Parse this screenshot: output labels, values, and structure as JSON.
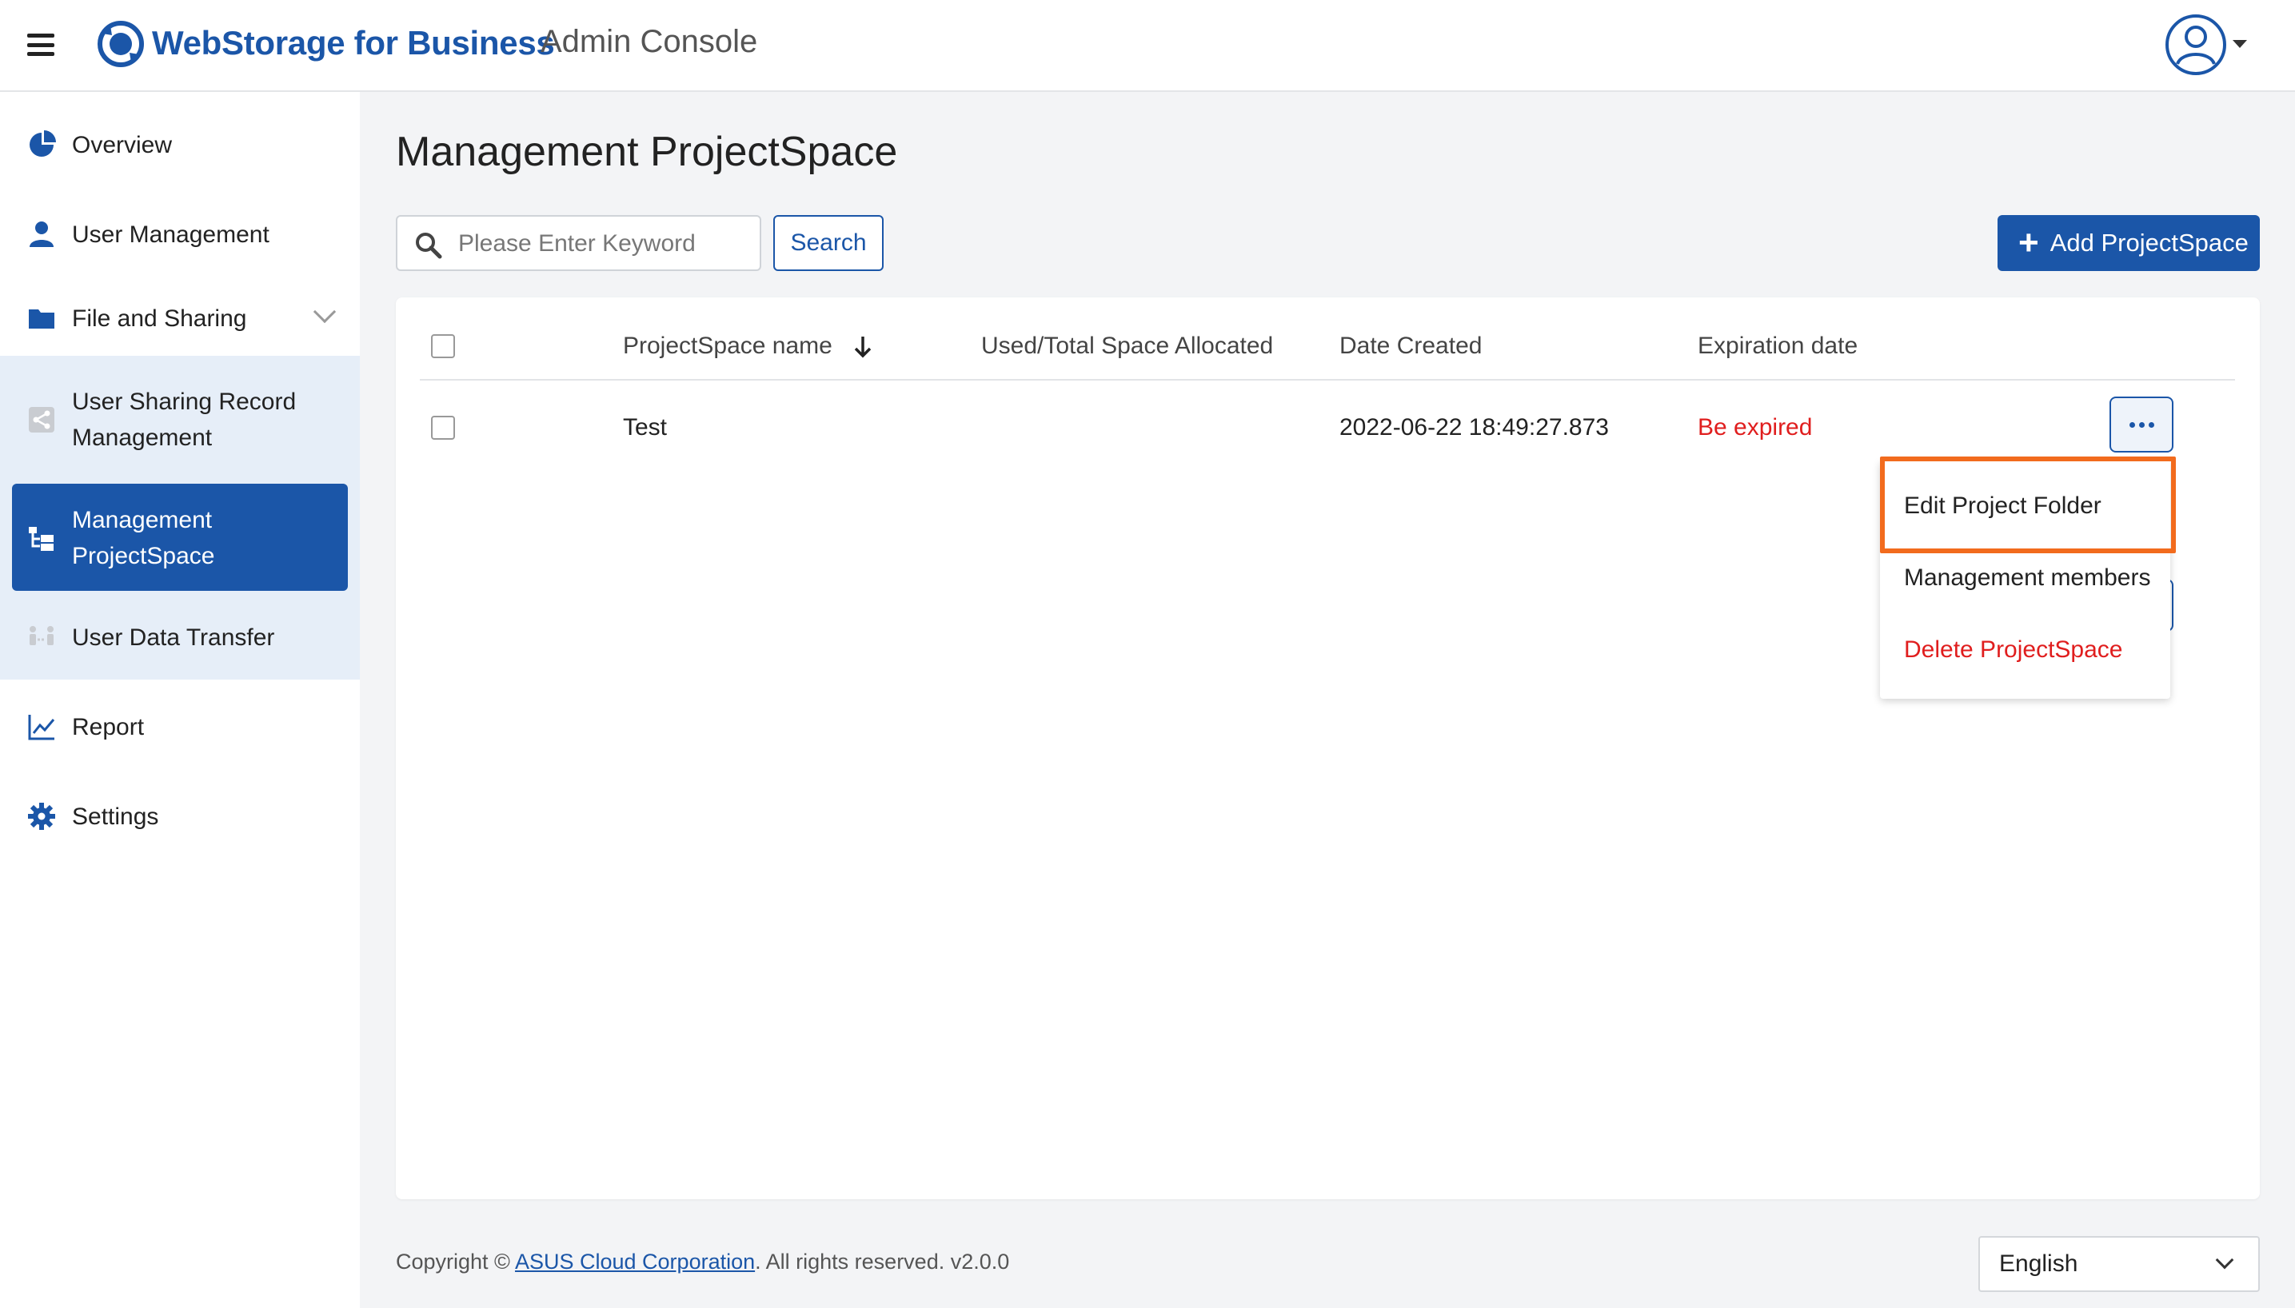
{
  "header": {
    "brand": "WebStorage for Business",
    "subtitle": "Admin Console",
    "menu_icon": "hamburger-icon",
    "avatar_icon": "user-avatar-icon",
    "brand_color": "#1b56a8"
  },
  "sidebar": {
    "items": [
      {
        "label": "Overview",
        "icon": "pie-chart-icon"
      },
      {
        "label": "User Management",
        "icon": "user-icon"
      },
      {
        "label": "File and Sharing",
        "icon": "folder-icon",
        "expanded": true
      },
      {
        "label": "User Sharing Record\nManagement",
        "icon": "share-icon"
      },
      {
        "label": "Management\nProjectSpace",
        "icon": "project-tree-icon",
        "active": true
      },
      {
        "label": "User Data Transfer",
        "icon": "transfer-icon"
      },
      {
        "label": "Report",
        "icon": "line-chart-icon"
      },
      {
        "label": "Settings",
        "icon": "gear-icon"
      }
    ]
  },
  "main": {
    "title": "Management ProjectSpace",
    "search": {
      "placeholder": "Please Enter Keyword",
      "value": "",
      "button": "Search"
    },
    "add_button": "Add ProjectSpace",
    "table": {
      "columns": [
        "ProjectSpace name",
        "Used/Total Space Allocated",
        "Date Created",
        "Expiration date"
      ],
      "sort_column": "ProjectSpace name",
      "rows": [
        {
          "name": "Test",
          "space": "",
          "created": "2022-06-22 18:49:27.873",
          "expiration": "Be expired"
        }
      ]
    },
    "row_menu": {
      "items": [
        "Edit Project Folder",
        "Management members",
        "Delete ProjectSpace"
      ],
      "highlighted": "Edit Project Folder"
    }
  },
  "footer": {
    "copyright_prefix": "Copyright ©",
    "company": "ASUS Cloud Corporation",
    "suffix": ". All rights reserved. v2.0.0",
    "language": "English"
  },
  "colors": {
    "accent": "#1b56a8",
    "danger": "#e01e1e",
    "highlight": "#f26b1d"
  }
}
